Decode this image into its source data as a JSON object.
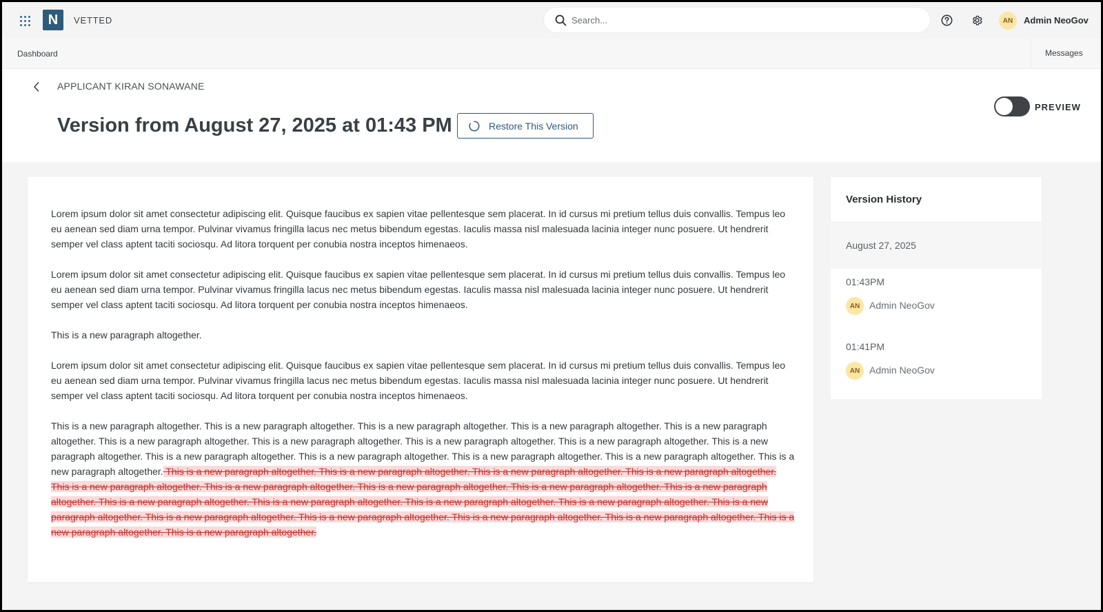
{
  "app": {
    "brand": "VETTED",
    "logo_letter": "N"
  },
  "search": {
    "placeholder": "Search..."
  },
  "user": {
    "initials": "AN",
    "name": "Admin NeoGov"
  },
  "nav": {
    "dashboard": "Dashboard",
    "messages": "Messages"
  },
  "header": {
    "breadcrumb": "APPLICANT KIRAN SONAWANE",
    "title": "Version from August 27, 2025 at 01:43 PM",
    "restore_label": "Restore This Version",
    "preview_label": "PREVIEW",
    "preview_on": false
  },
  "document": {
    "paragraphs": [
      "Lorem ipsum dolor sit amet consectetur adipiscing elit. Quisque faucibus ex sapien vitae pellentesque sem placerat. In id cursus mi pretium tellus duis convallis. Tempus leo eu aenean sed diam urna tempor. Pulvinar vivamus fringilla lacus nec metus bibendum egestas. Iaculis massa nisl malesuada lacinia integer nunc posuere. Ut hendrerit semper vel class aptent taciti sociosqu. Ad litora torquent per conubia nostra inceptos himenaeos.",
      "Lorem ipsum dolor sit amet consectetur adipiscing elit. Quisque faucibus ex sapien vitae pellentesque sem placerat. In id cursus mi pretium tellus duis convallis. Tempus leo eu aenean sed diam urna tempor. Pulvinar vivamus fringilla lacus nec metus bibendum egestas. Iaculis massa nisl malesuada lacinia integer nunc posuere. Ut hendrerit semper vel class aptent taciti sociosqu. Ad litora torquent per conubia nostra inceptos himenaeos.",
      "This is a new paragraph altogether.",
      "Lorem ipsum dolor sit amet consectetur adipiscing elit. Quisque faucibus ex sapien vitae pellentesque sem placerat. In id cursus mi pretium tellus duis convallis. Tempus leo eu aenean sed diam urna tempor. Pulvinar vivamus fringilla lacus nec metus bibendum egestas. Iaculis massa nisl malesuada lacinia integer nunc posuere. Ut hendrerit semper vel class aptent taciti sociosqu. Ad litora torquent per conubia nostra inceptos himenaeos."
    ],
    "last_paragraph_kept": "This is a new paragraph altogether. This is a new paragraph altogether. This is a new paragraph altogether. This is a new paragraph altogether. This is a new paragraph altogether. This is a new paragraph altogether. This is a new paragraph altogether. This is a new paragraph altogether. This is a new paragraph altogether. This is a new paragraph altogether. This is a new paragraph altogether. This is a new paragraph altogether. This is a new paragraph altogether. This is a new paragraph altogether. This is a new paragraph altogether.",
    "last_paragraph_deleted": " This is a new paragraph altogether. This is a new paragraph altogether. This is a new paragraph altogether. This is a new paragraph altogether. This is a new paragraph altogether. This is a new paragraph altogether. This is a new paragraph altogether. This is a new paragraph altogether. This is a new paragraph altogether. This is a new paragraph altogether. This is a new paragraph altogether. This is a new paragraph altogether. This is a new paragraph altogether. This is a new paragraph altogether. This is a new paragraph altogether. This is a new paragraph altogether. This is a new paragraph altogether. This is a new paragraph altogether. This is a new paragraph altogether. This is a new paragraph altogether. "
  },
  "history": {
    "title": "Version History",
    "date": "August 27, 2025",
    "entries": [
      {
        "time": "01:43PM",
        "initials": "AN",
        "author": "Admin NeoGov"
      },
      {
        "time": "01:41PM",
        "initials": "AN",
        "author": "Admin NeoGov"
      }
    ]
  },
  "colors": {
    "brand": "#2e5b7a",
    "deleted_bg": "#fbdada",
    "deleted_text": "#c9302c",
    "avatar_bg": "#fbe6a6"
  },
  "icons": {
    "apps": "apps-grid-icon",
    "search": "search-icon",
    "help": "help-icon",
    "settings": "gear-icon",
    "back": "chevron-left-icon",
    "restore": "restore-icon"
  }
}
